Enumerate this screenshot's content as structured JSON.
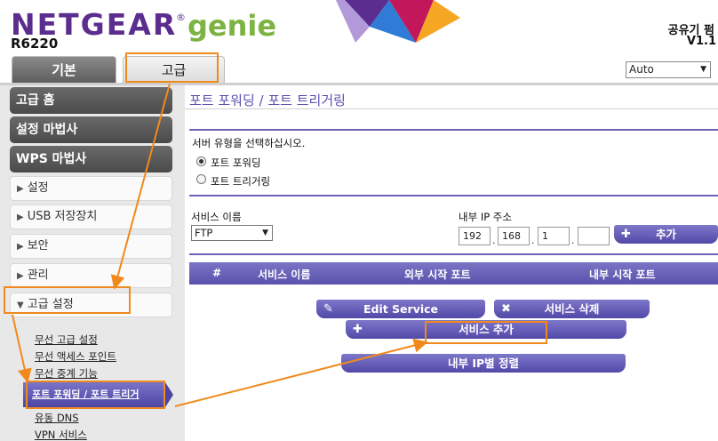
{
  "header": {
    "brand": "NETGEAR",
    "brand_mark": "®",
    "product": "genie",
    "model": "R6220",
    "firmware_label": "공유기 펌",
    "firmware_version": "V1.1"
  },
  "tabs": [
    {
      "label": "기본"
    },
    {
      "label": "고급"
    }
  ],
  "language": {
    "selected": "Auto"
  },
  "sidebar": {
    "items": [
      {
        "label": "고급 홈"
      },
      {
        "label": "설정 마법사"
      },
      {
        "label": "WPS 마법사"
      },
      {
        "label": "설정"
      },
      {
        "label": "USB 저장장치"
      },
      {
        "label": "보안"
      },
      {
        "label": "관리"
      },
      {
        "label": "고급 설정"
      }
    ],
    "sub_items": [
      {
        "label": "무선 고급 설정"
      },
      {
        "label": "무선 액세스 포인트"
      },
      {
        "label": "무선 중계 기능"
      },
      {
        "label": "포트 포워딩 / 포트 트리거"
      },
      {
        "label": "유동 DNS"
      },
      {
        "label": "VPN 서비스"
      }
    ]
  },
  "main": {
    "title": "포트 포워딩 / 포트 트리거링",
    "server_type_prompt": "서버 유형을 선택하십시오.",
    "radio_forwarding": "포트 포워딩",
    "radio_triggering": "포트 트리거링",
    "service_name_label": "서비스 이름",
    "service_name_value": "FTP",
    "internal_ip_label": "내부 IP 주소",
    "ip": [
      "192",
      "168",
      "1",
      ""
    ],
    "add_button": "추가",
    "table_headers": [
      "#",
      "서비스 이름",
      "외부 시작 포트",
      "내부 시작 포트"
    ],
    "edit_button": "Edit Service",
    "delete_button": "서비스 삭제",
    "add_service_button": "서비스 추가",
    "sort_button": "내부 IP별 정렬"
  },
  "colors": {
    "brand_purple": "#5b2d8e",
    "genie_green": "#7cb342",
    "button_purple": "#5249a8",
    "highlight_orange": "#f08a1c"
  }
}
